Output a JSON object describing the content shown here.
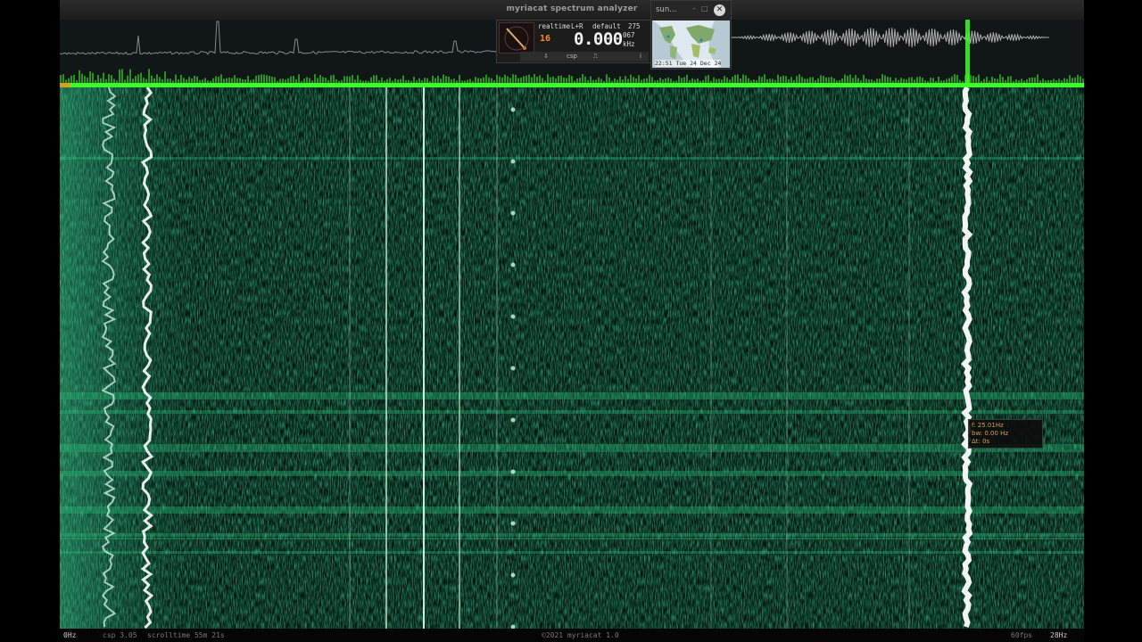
{
  "window": {
    "title": "myriacat spectrum analyzer",
    "min_label": "–",
    "max_label": "□",
    "close_label": "✕"
  },
  "meter": {
    "mode": "realtime",
    "channel": "L+R",
    "preset": "default",
    "count": "275",
    "small_digits": "16",
    "readout": "0.000",
    "readout_sub": "067",
    "unit": "kHz",
    "btn_1": "⇩",
    "btn_2": "csp",
    "btn_3": "⎍",
    "btn_4": "i"
  },
  "sun_window": {
    "title": "sun...",
    "min_label": "–",
    "max_label": "□",
    "close_label": "✕",
    "time": "22:51 Tue 24 Dec 24"
  },
  "tooltip": {
    "f": "f: 25.01Hz",
    "bw": "bw: 0.00 Hz",
    "t": "Δt: 0s"
  },
  "status": {
    "freq_start": "0Hz",
    "csp": "csp 3.05",
    "scrolltime": "scrolltime 55m 21s",
    "copyright": "©2021 myriacat 1.0",
    "fps": "60fps",
    "freq_end": "28Hz"
  },
  "colors": {
    "accent_green": "#3cff2a",
    "waterfall_bg": "#031a10",
    "trace_white": "#ffffff",
    "tooltip_text": "#d9a04a"
  }
}
